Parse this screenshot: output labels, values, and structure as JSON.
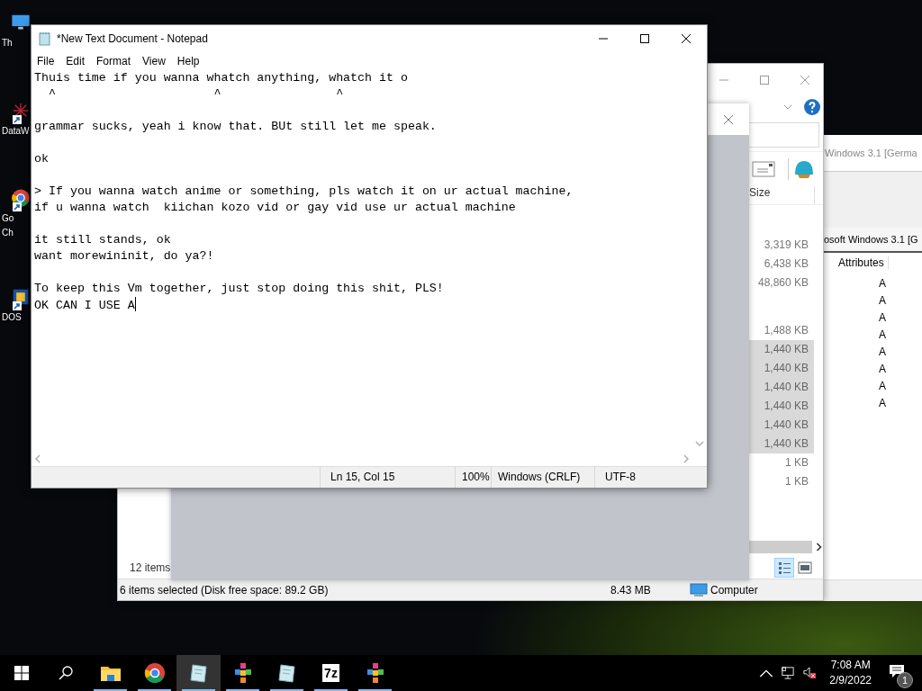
{
  "desktop_icons": [
    {
      "kind": "pc",
      "shortcut": false,
      "label_lines": [
        "Th"
      ]
    },
    {
      "kind": "star",
      "shortcut": true,
      "label_lines": [
        "DataW"
      ]
    },
    {
      "kind": "browser",
      "shortcut": true,
      "label_lines": [
        "Go",
        "Ch"
      ]
    },
    {
      "kind": "dos",
      "shortcut": true,
      "label_lines": [
        "DOS"
      ]
    }
  ],
  "back_window": {
    "title": "Windows 3.1 [Germa",
    "path": "osoft Windows 3.1 [G",
    "column": "Attributes",
    "attributes": [
      "A",
      "A",
      "A",
      "A",
      "A",
      "A",
      "A",
      "A"
    ]
  },
  "explorer": {
    "size_column": "Size",
    "size_groups": [
      [
        {
          "size": "3,319 KB",
          "selected": false
        },
        {
          "size": "6,438 KB",
          "selected": false
        },
        {
          "size": "48,860 KB",
          "selected": false
        }
      ],
      [
        {
          "size": "1,488 KB",
          "selected": false
        },
        {
          "size": "1,440 KB",
          "selected": true
        },
        {
          "size": "1,440 KB",
          "selected": true
        },
        {
          "size": "1,440 KB",
          "selected": true
        },
        {
          "size": "1,440 KB",
          "selected": true
        },
        {
          "size": "1,440 KB",
          "selected": true
        },
        {
          "size": "1,440 KB",
          "selected": true
        },
        {
          "size": "1 KB",
          "selected": false
        },
        {
          "size": "1 KB",
          "selected": false
        }
      ]
    ],
    "item_count": "12 items",
    "status": "6 items selected (Disk free space: 89.2 GB)",
    "selection_size": "8.43 MB",
    "zone": "Computer"
  },
  "notepad": {
    "title": "*New Text Document - Notepad",
    "menu": [
      "File",
      "Edit",
      "Format",
      "View",
      "Help"
    ],
    "text": "Thuis time if you wanna whatch anything, whatch it o\n  ^                      ^                ^\n\ngrammar sucks, yeah i know that. BUt still let me speak.\n\nok\n\n> If you wanna watch anime or something, pls watch it on ur actual machine,\nif u wanna watch  kiichan kozo vid or gay vid use ur actual machine\n\nit still stands, ok\nwant morewininit, do ya?!\n\nTo keep this Vm together, just stop doing this shit, PLS!\nOK CAN I USE A",
    "status": {
      "position": "Ln 15, Col 15",
      "zoom": "100%",
      "line_ending": "Windows (CRLF)",
      "encoding": "UTF-8"
    }
  },
  "taskbar": {
    "apps": [
      {
        "kind": "explorer",
        "running": true,
        "selected": false
      },
      {
        "kind": "chrome",
        "running": true,
        "selected": false
      },
      {
        "kind": "notepad",
        "running": true,
        "selected": true
      },
      {
        "kind": "dosbox",
        "running": true,
        "selected": false
      },
      {
        "kind": "notepad",
        "running": true,
        "selected": false
      },
      {
        "kind": "archiver",
        "glyph": "7z",
        "running": true,
        "selected": false
      },
      {
        "kind": "dosbox",
        "running": true,
        "selected": false
      }
    ],
    "volume_muted": true,
    "time": "7:08 AM",
    "date": "2/9/2022",
    "notification_count": "1"
  }
}
